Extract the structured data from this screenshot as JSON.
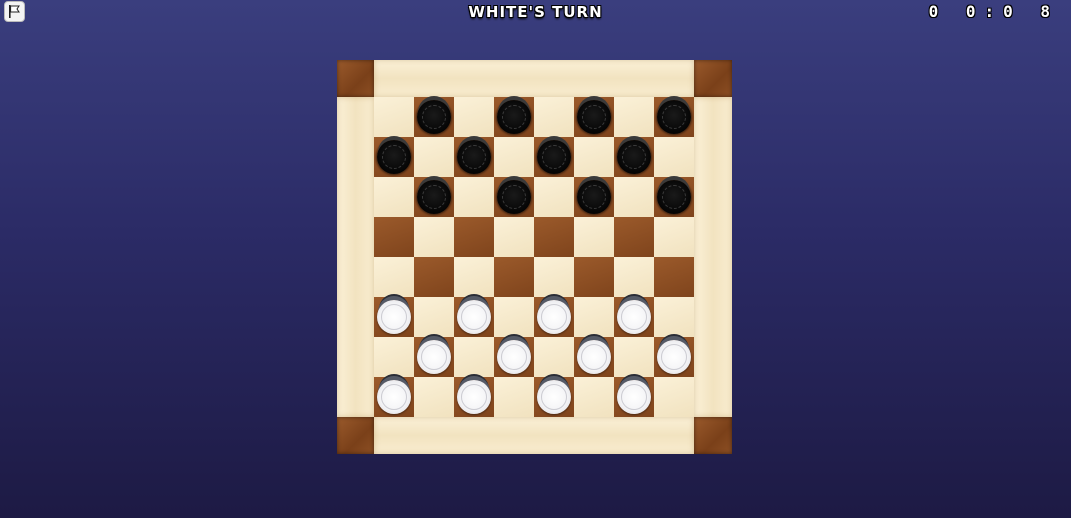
{
  "header": {
    "menu_icon": "flag-icon",
    "turn_text": "WHITE'S TURN",
    "timer_text": "0 0:0 8"
  },
  "colors": {
    "background_top": "#3a3e7e",
    "background_bottom": "#1d1a44",
    "light_square": "#f6e9cc",
    "dark_square": "#8b4d22",
    "black_piece": "#0a0a0a",
    "white_piece": "#f6f6f8"
  },
  "board": {
    "size": 8,
    "rows": [
      ".b.b.b.b",
      "b.b.b.b.",
      ".b.b.b.b",
      "........",
      "........",
      "w.w.w.w.",
      ".w.w.w.w",
      "w.w.w.w."
    ]
  }
}
